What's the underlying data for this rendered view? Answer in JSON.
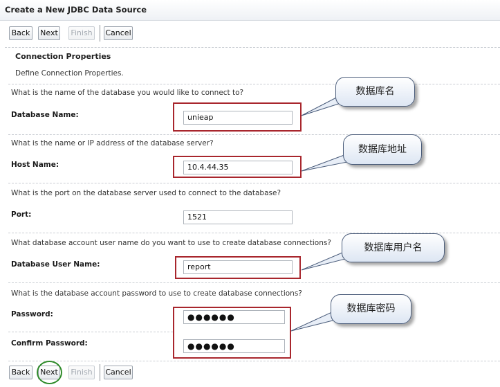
{
  "window": {
    "title": "Create a New JDBC Data Source"
  },
  "toolbar": {
    "back": "Back",
    "next": "Next",
    "finish": "Finish",
    "cancel": "Cancel"
  },
  "section": {
    "title": "Connection Properties",
    "description": "Define Connection Properties."
  },
  "fields": {
    "database_name": {
      "question": "What is the name of the database you would like to connect to?",
      "label": "Database Name:",
      "value": "unieap"
    },
    "host_name": {
      "question": "What is the name or IP address of the database server?",
      "label": "Host Name:",
      "value": "10.4.44.35"
    },
    "port": {
      "question": "What is the port on the database server used to connect to the database?",
      "label": "Port:",
      "value": "1521"
    },
    "user_name": {
      "question": "What database account user name do you want to use to create database connections?",
      "label": "Database User Name:",
      "value": "report"
    },
    "password": {
      "question": "What is the database account password to use to create database connections?",
      "label": "Password:",
      "value": "●●●●●●"
    },
    "confirm_password": {
      "label": "Confirm Password:",
      "value": "●●●●●●"
    }
  },
  "callouts": {
    "database_name": "数据库名",
    "host_name": "数据库地址",
    "user_name": "数据库用户名",
    "password": "数据库密码"
  },
  "colors": {
    "highlight_box": "#a8262d",
    "next_circle": "#2f8b2a",
    "callout_border": "#4a5c7a"
  }
}
